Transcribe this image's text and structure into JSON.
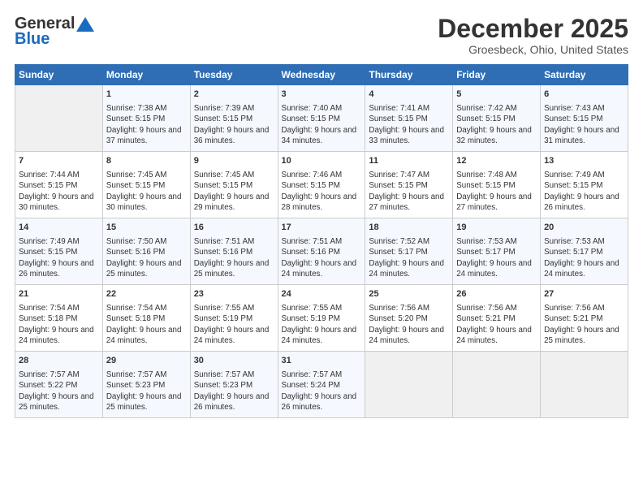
{
  "header": {
    "logo_general": "General",
    "logo_blue": "Blue",
    "title": "December 2025",
    "subtitle": "Groesbeck, Ohio, United States"
  },
  "days_of_week": [
    "Sunday",
    "Monday",
    "Tuesday",
    "Wednesday",
    "Thursday",
    "Friday",
    "Saturday"
  ],
  "weeks": [
    [
      {
        "day": "",
        "empty": true
      },
      {
        "day": "1",
        "sunrise": "7:38 AM",
        "sunset": "5:15 PM",
        "daylight": "9 hours and 37 minutes."
      },
      {
        "day": "2",
        "sunrise": "7:39 AM",
        "sunset": "5:15 PM",
        "daylight": "9 hours and 36 minutes."
      },
      {
        "day": "3",
        "sunrise": "7:40 AM",
        "sunset": "5:15 PM",
        "daylight": "9 hours and 34 minutes."
      },
      {
        "day": "4",
        "sunrise": "7:41 AM",
        "sunset": "5:15 PM",
        "daylight": "9 hours and 33 minutes."
      },
      {
        "day": "5",
        "sunrise": "7:42 AM",
        "sunset": "5:15 PM",
        "daylight": "9 hours and 32 minutes."
      },
      {
        "day": "6",
        "sunrise": "7:43 AM",
        "sunset": "5:15 PM",
        "daylight": "9 hours and 31 minutes."
      }
    ],
    [
      {
        "day": "7",
        "sunrise": "7:44 AM",
        "sunset": "5:15 PM",
        "daylight": "9 hours and 30 minutes."
      },
      {
        "day": "8",
        "sunrise": "7:45 AM",
        "sunset": "5:15 PM",
        "daylight": "9 hours and 30 minutes."
      },
      {
        "day": "9",
        "sunrise": "7:45 AM",
        "sunset": "5:15 PM",
        "daylight": "9 hours and 29 minutes."
      },
      {
        "day": "10",
        "sunrise": "7:46 AM",
        "sunset": "5:15 PM",
        "daylight": "9 hours and 28 minutes."
      },
      {
        "day": "11",
        "sunrise": "7:47 AM",
        "sunset": "5:15 PM",
        "daylight": "9 hours and 27 minutes."
      },
      {
        "day": "12",
        "sunrise": "7:48 AM",
        "sunset": "5:15 PM",
        "daylight": "9 hours and 27 minutes."
      },
      {
        "day": "13",
        "sunrise": "7:49 AM",
        "sunset": "5:15 PM",
        "daylight": "9 hours and 26 minutes."
      }
    ],
    [
      {
        "day": "14",
        "sunrise": "7:49 AM",
        "sunset": "5:15 PM",
        "daylight": "9 hours and 26 minutes."
      },
      {
        "day": "15",
        "sunrise": "7:50 AM",
        "sunset": "5:16 PM",
        "daylight": "9 hours and 25 minutes."
      },
      {
        "day": "16",
        "sunrise": "7:51 AM",
        "sunset": "5:16 PM",
        "daylight": "9 hours and 25 minutes."
      },
      {
        "day": "17",
        "sunrise": "7:51 AM",
        "sunset": "5:16 PM",
        "daylight": "9 hours and 24 minutes."
      },
      {
        "day": "18",
        "sunrise": "7:52 AM",
        "sunset": "5:17 PM",
        "daylight": "9 hours and 24 minutes."
      },
      {
        "day": "19",
        "sunrise": "7:53 AM",
        "sunset": "5:17 PM",
        "daylight": "9 hours and 24 minutes."
      },
      {
        "day": "20",
        "sunrise": "7:53 AM",
        "sunset": "5:17 PM",
        "daylight": "9 hours and 24 minutes."
      }
    ],
    [
      {
        "day": "21",
        "sunrise": "7:54 AM",
        "sunset": "5:18 PM",
        "daylight": "9 hours and 24 minutes."
      },
      {
        "day": "22",
        "sunrise": "7:54 AM",
        "sunset": "5:18 PM",
        "daylight": "9 hours and 24 minutes."
      },
      {
        "day": "23",
        "sunrise": "7:55 AM",
        "sunset": "5:19 PM",
        "daylight": "9 hours and 24 minutes."
      },
      {
        "day": "24",
        "sunrise": "7:55 AM",
        "sunset": "5:19 PM",
        "daylight": "9 hours and 24 minutes."
      },
      {
        "day": "25",
        "sunrise": "7:56 AM",
        "sunset": "5:20 PM",
        "daylight": "9 hours and 24 minutes."
      },
      {
        "day": "26",
        "sunrise": "7:56 AM",
        "sunset": "5:21 PM",
        "daylight": "9 hours and 24 minutes."
      },
      {
        "day": "27",
        "sunrise": "7:56 AM",
        "sunset": "5:21 PM",
        "daylight": "9 hours and 25 minutes."
      }
    ],
    [
      {
        "day": "28",
        "sunrise": "7:57 AM",
        "sunset": "5:22 PM",
        "daylight": "9 hours and 25 minutes."
      },
      {
        "day": "29",
        "sunrise": "7:57 AM",
        "sunset": "5:23 PM",
        "daylight": "9 hours and 25 minutes."
      },
      {
        "day": "30",
        "sunrise": "7:57 AM",
        "sunset": "5:23 PM",
        "daylight": "9 hours and 26 minutes."
      },
      {
        "day": "31",
        "sunrise": "7:57 AM",
        "sunset": "5:24 PM",
        "daylight": "9 hours and 26 minutes."
      },
      {
        "day": "",
        "empty": true
      },
      {
        "day": "",
        "empty": true
      },
      {
        "day": "",
        "empty": true
      }
    ]
  ]
}
